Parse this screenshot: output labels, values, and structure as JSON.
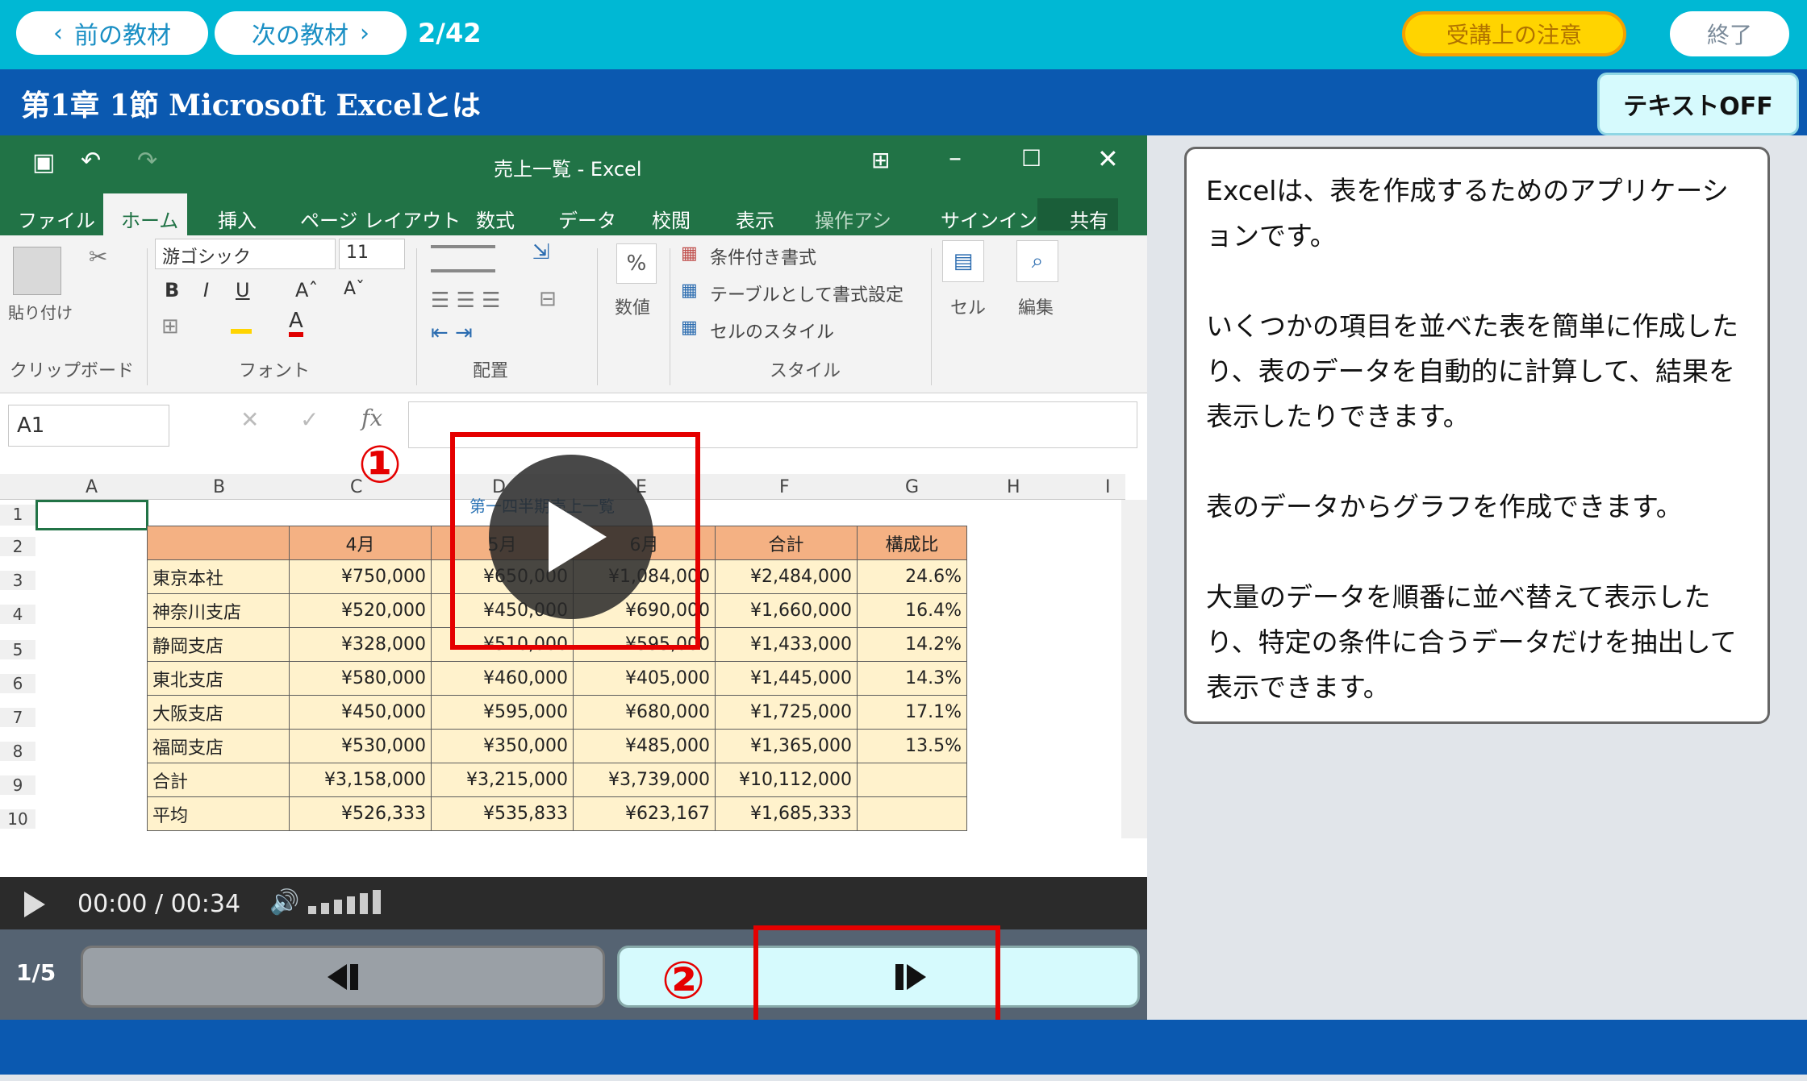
{
  "topbar": {
    "prev_label": "前の教材",
    "next_label": "次の教材",
    "counter": "2/42",
    "notice_label": "受講上の注意",
    "end_label": "終了"
  },
  "header": {
    "title": "第1章 1節 Microsoft Excelとは",
    "text_toggle": "テキストOFF"
  },
  "excel": {
    "window_title": "売上一覧 - Excel",
    "tabs": [
      "ファイル",
      "ホーム",
      "挿入",
      "ページ レイアウト",
      "数式",
      "データ",
      "校閲",
      "表示",
      "操作アシ",
      "サインイン",
      "共有"
    ],
    "font_name": "游ゴシック",
    "font_size": "11",
    "groups": [
      "クリップボード",
      "フォント",
      "配置",
      "スタイル"
    ],
    "paste_label": "貼り付け",
    "number_label": "数値",
    "cell_label": "セル",
    "edit_label": "編集",
    "style_items": [
      "条件付き書式",
      "テーブルとして書式設定",
      "セルのスタイル"
    ],
    "name_box": "A1",
    "columns": [
      "A",
      "B",
      "C",
      "D",
      "E",
      "F",
      "G",
      "H",
      "I"
    ],
    "rows": [
      "1",
      "2",
      "3",
      "4",
      "5",
      "6",
      "7",
      "8",
      "9",
      "10"
    ],
    "sheet_title": "第一四半期売上一覧",
    "table_header": [
      "",
      "4月",
      "5月",
      "6月",
      "合計",
      "構成比"
    ],
    "table_rows": [
      [
        "東京本社",
        "¥750,000",
        "¥650,000",
        "¥1,084,000",
        "¥2,484,000",
        "24.6%"
      ],
      [
        "神奈川支店",
        "¥520,000",
        "¥450,000",
        "¥690,000",
        "¥1,660,000",
        "16.4%"
      ],
      [
        "静岡支店",
        "¥328,000",
        "¥510,000",
        "¥595,000",
        "¥1,433,000",
        "14.2%"
      ],
      [
        "東北支店",
        "¥580,000",
        "¥460,000",
        "¥405,000",
        "¥1,445,000",
        "14.3%"
      ],
      [
        "大阪支店",
        "¥450,000",
        "¥595,000",
        "¥680,000",
        "¥1,725,000",
        "17.1%"
      ],
      [
        "福岡支店",
        "¥530,000",
        "¥350,000",
        "¥485,000",
        "¥1,365,000",
        "13.5%"
      ],
      [
        "合計",
        "¥3,158,000",
        "¥3,215,000",
        "¥3,739,000",
        "¥10,112,000",
        ""
      ],
      [
        "平均",
        "¥526,333",
        "¥535,833",
        "¥623,167",
        "¥1,685,333",
        ""
      ]
    ]
  },
  "player": {
    "time": "00:00 / 00:34"
  },
  "nav": {
    "page": "1/5"
  },
  "callouts": {
    "one": "①",
    "two": "②"
  },
  "text_panel": {
    "paragraphs": [
      "Excelは、表を作成するためのアプリケーションです。",
      "いくつかの項目を並べた表を簡単に作成したり、表のデータを自動的に計算して、結果を表示したりできます。",
      "表のデータからグラフを作成できます。",
      "大量のデータを順番に並べ替えて表示したり、特定の条件に合うデータだけを抽出して表示できます。"
    ]
  },
  "colors": {
    "topbar": "#00b8d4",
    "titlebar": "#0b59b0",
    "excel_green": "#217346",
    "callout_red": "#e50000"
  }
}
